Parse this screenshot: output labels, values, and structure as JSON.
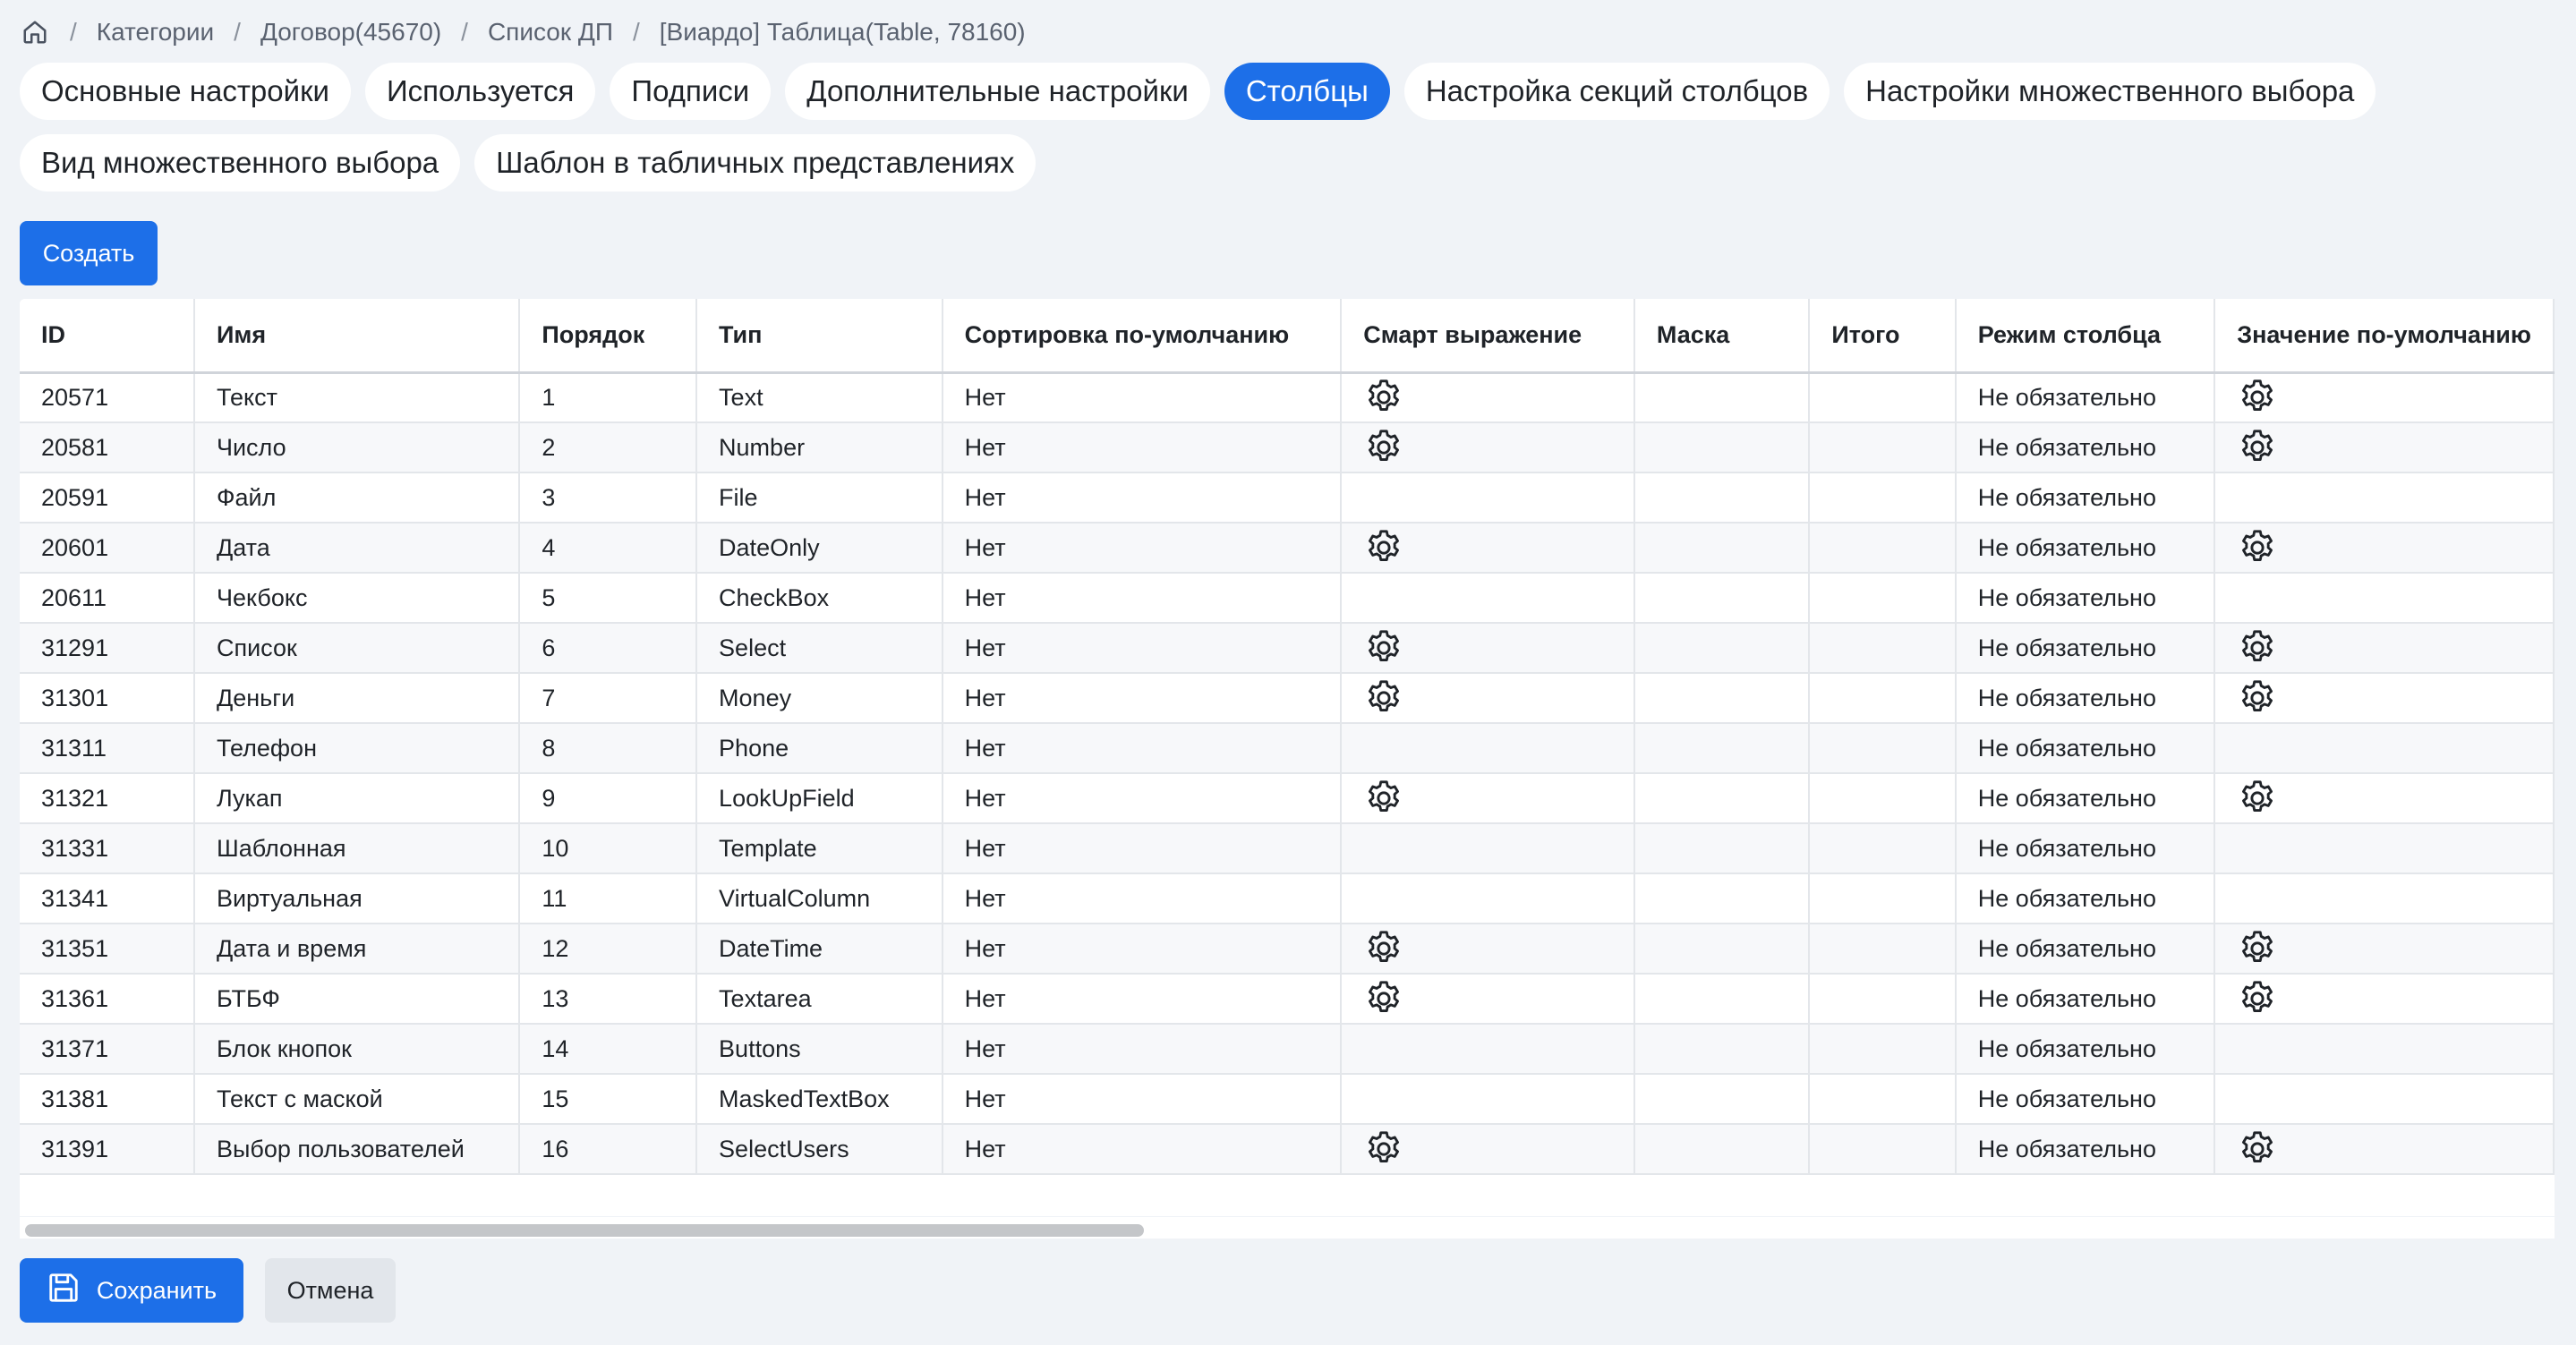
{
  "breadcrumb": {
    "items": [
      "Категории",
      "Договор(45670)",
      "Список ДП",
      "[Виардо] Таблица(Table, 78160)"
    ]
  },
  "tabs": [
    {
      "label": "Основные настройки",
      "active": false
    },
    {
      "label": "Используется",
      "active": false
    },
    {
      "label": "Подписи",
      "active": false
    },
    {
      "label": "Дополнительные настройки",
      "active": false
    },
    {
      "label": "Столбцы",
      "active": true
    },
    {
      "label": "Настройка секций столбцов",
      "active": false
    },
    {
      "label": "Настройки множественного выбора",
      "active": false
    },
    {
      "label": "Вид множественного выбора",
      "active": false
    },
    {
      "label": "Шаблон в табличных представлениях",
      "active": false
    }
  ],
  "toolbar": {
    "create_label": "Создать"
  },
  "table": {
    "columns": [
      "ID",
      "Имя",
      "Порядок",
      "Тип",
      "Сортировка по-умолчанию",
      "Смарт выражение",
      "Маска",
      "Итого",
      "Режим столбца",
      "Значение по-умолчанию"
    ],
    "rows": [
      {
        "id": "20571",
        "name": "Текст",
        "order": "1",
        "type": "Text",
        "sort": "Нет",
        "smart": true,
        "mask": "",
        "total": "",
        "mode": "Не обязательно",
        "default": true
      },
      {
        "id": "20581",
        "name": "Число",
        "order": "2",
        "type": "Number",
        "sort": "Нет",
        "smart": true,
        "mask": "",
        "total": "",
        "mode": "Не обязательно",
        "default": true
      },
      {
        "id": "20591",
        "name": "Файл",
        "order": "3",
        "type": "File",
        "sort": "Нет",
        "smart": false,
        "mask": "",
        "total": "",
        "mode": "Не обязательно",
        "default": false
      },
      {
        "id": "20601",
        "name": "Дата",
        "order": "4",
        "type": "DateOnly",
        "sort": "Нет",
        "smart": true,
        "mask": "",
        "total": "",
        "mode": "Не обязательно",
        "default": true
      },
      {
        "id": "20611",
        "name": "Чекбокс",
        "order": "5",
        "type": "CheckBox",
        "sort": "Нет",
        "smart": false,
        "mask": "",
        "total": "",
        "mode": "Не обязательно",
        "default": false
      },
      {
        "id": "31291",
        "name": "Список",
        "order": "6",
        "type": "Select",
        "sort": "Нет",
        "smart": true,
        "mask": "",
        "total": "",
        "mode": "Не обязательно",
        "default": true
      },
      {
        "id": "31301",
        "name": "Деньги",
        "order": "7",
        "type": "Money",
        "sort": "Нет",
        "smart": true,
        "mask": "",
        "total": "",
        "mode": "Не обязательно",
        "default": true
      },
      {
        "id": "31311",
        "name": "Телефон",
        "order": "8",
        "type": "Phone",
        "sort": "Нет",
        "smart": false,
        "mask": "",
        "total": "",
        "mode": "Не обязательно",
        "default": false
      },
      {
        "id": "31321",
        "name": "Лукап",
        "order": "9",
        "type": "LookUpField",
        "sort": "Нет",
        "smart": true,
        "mask": "",
        "total": "",
        "mode": "Не обязательно",
        "default": true
      },
      {
        "id": "31331",
        "name": "Шаблонная",
        "order": "10",
        "type": "Template",
        "sort": "Нет",
        "smart": false,
        "mask": "",
        "total": "",
        "mode": "Не обязательно",
        "default": false
      },
      {
        "id": "31341",
        "name": "Виртуальная",
        "order": "11",
        "type": "VirtualColumn",
        "sort": "Нет",
        "smart": false,
        "mask": "",
        "total": "",
        "mode": "Не обязательно",
        "default": false
      },
      {
        "id": "31351",
        "name": "Дата и время",
        "order": "12",
        "type": "DateTime",
        "sort": "Нет",
        "smart": true,
        "mask": "",
        "total": "",
        "mode": "Не обязательно",
        "default": true
      },
      {
        "id": "31361",
        "name": "БТБФ",
        "order": "13",
        "type": "Textarea",
        "sort": "Нет",
        "smart": true,
        "mask": "",
        "total": "",
        "mode": "Не обязательно",
        "default": true
      },
      {
        "id": "31371",
        "name": "Блок кнопок",
        "order": "14",
        "type": "Buttons",
        "sort": "Нет",
        "smart": false,
        "mask": "",
        "total": "",
        "mode": "Не обязательно",
        "default": false
      },
      {
        "id": "31381",
        "name": "Текст с маской",
        "order": "15",
        "type": "MaskedTextBox",
        "sort": "Нет",
        "smart": false,
        "mask": "",
        "total": "",
        "mode": "Не обязательно",
        "default": false
      },
      {
        "id": "31391",
        "name": "Выбор пользователей",
        "order": "16",
        "type": "SelectUsers",
        "sort": "Нет",
        "smart": true,
        "mask": "",
        "total": "",
        "mode": "Не обязательно",
        "default": true
      }
    ]
  },
  "footer": {
    "save_label": "Сохранить",
    "cancel_label": "Отмена"
  },
  "colors": {
    "accent": "#1d6fe8",
    "background": "#f0f3f7"
  },
  "icons": {
    "home": "home-icon",
    "settings": "gear-icon",
    "save": "floppy-disk-icon"
  }
}
